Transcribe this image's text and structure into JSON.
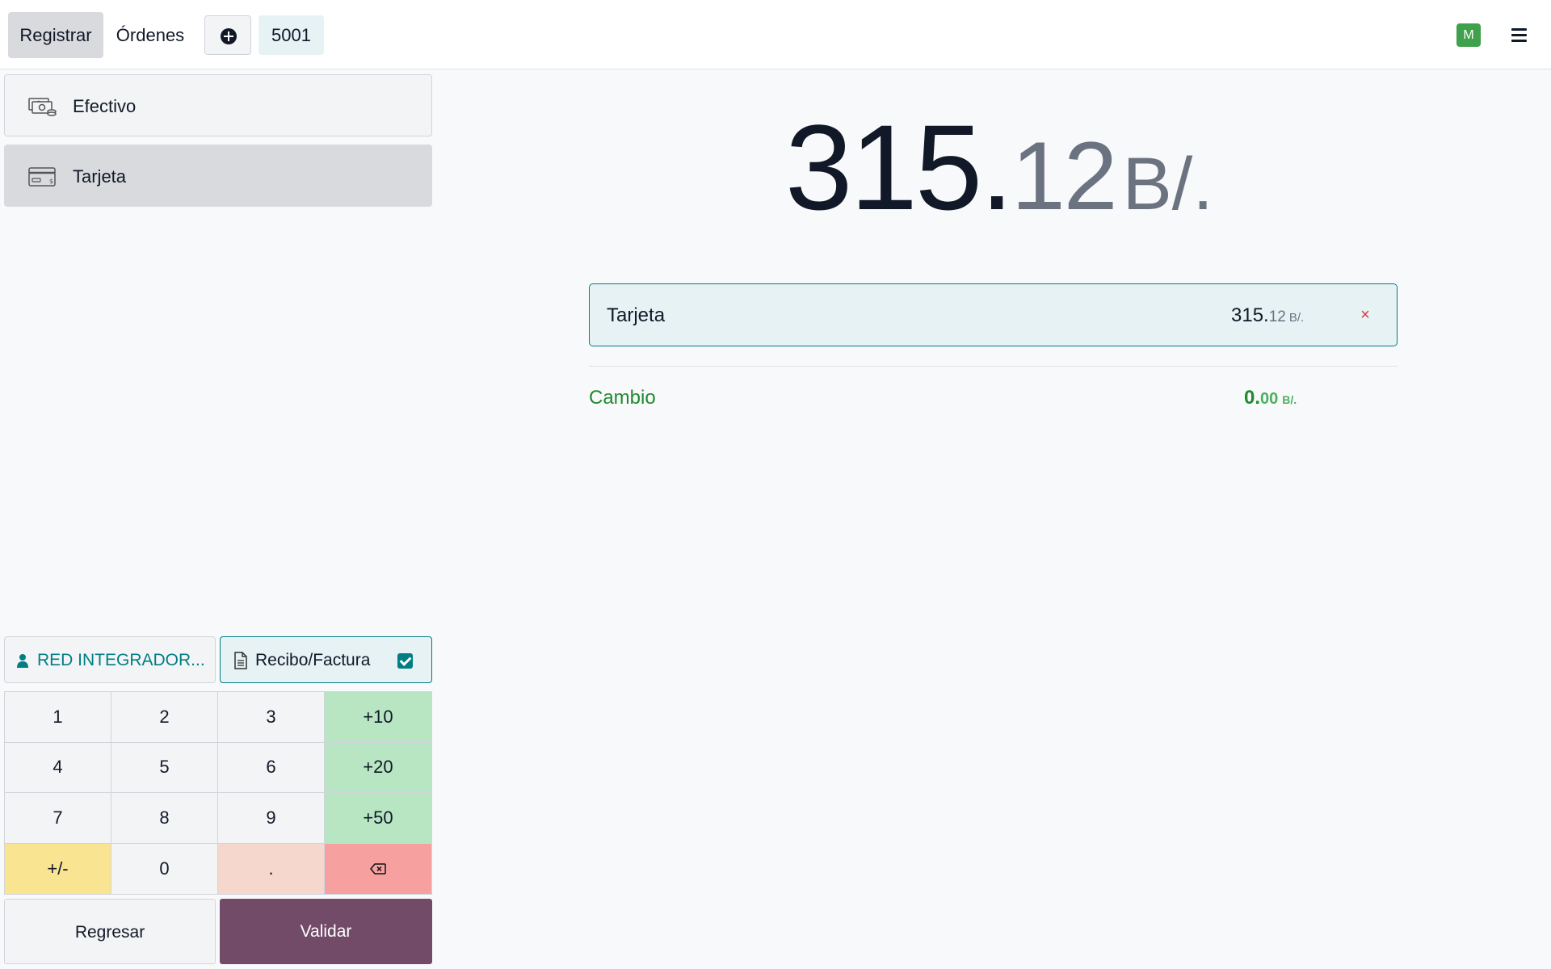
{
  "topbar": {
    "register_label": "Registrar",
    "orders_label": "Órdenes",
    "order_number": "5001",
    "avatar_initial": "M",
    "avatar_color": "#3fa14c"
  },
  "payment_methods": [
    {
      "label": "Efectivo",
      "icon": "cash-icon",
      "selected": false
    },
    {
      "label": "Tarjeta",
      "icon": "credit-card-icon",
      "selected": true
    }
  ],
  "customer": {
    "label": "RED INTEGRADOR..."
  },
  "invoice": {
    "label": "Recibo/Factura",
    "checked": true
  },
  "numpad": {
    "keys": [
      "1",
      "2",
      "3",
      "+10",
      "4",
      "5",
      "6",
      "+20",
      "7",
      "8",
      "9",
      "+50",
      "+/-",
      "0",
      "."
    ],
    "backspace_icon": "backspace-icon"
  },
  "actions": {
    "back_label": "Regresar",
    "validate_label": "Validar",
    "validate_color": "#714b67"
  },
  "total": {
    "integer": "315.",
    "decimals": "12",
    "currency": "B/."
  },
  "payment_lines": [
    {
      "method": "Tarjeta",
      "amount_integer": "315.",
      "amount_decimals": "12",
      "currency": "B/."
    }
  ],
  "change": {
    "label": "Cambio",
    "integer": "0.",
    "decimals": "00",
    "currency": "B/.",
    "color": "#1f8a2f"
  },
  "colors": {
    "accent": "#017e84",
    "danger": "#dc3545"
  }
}
